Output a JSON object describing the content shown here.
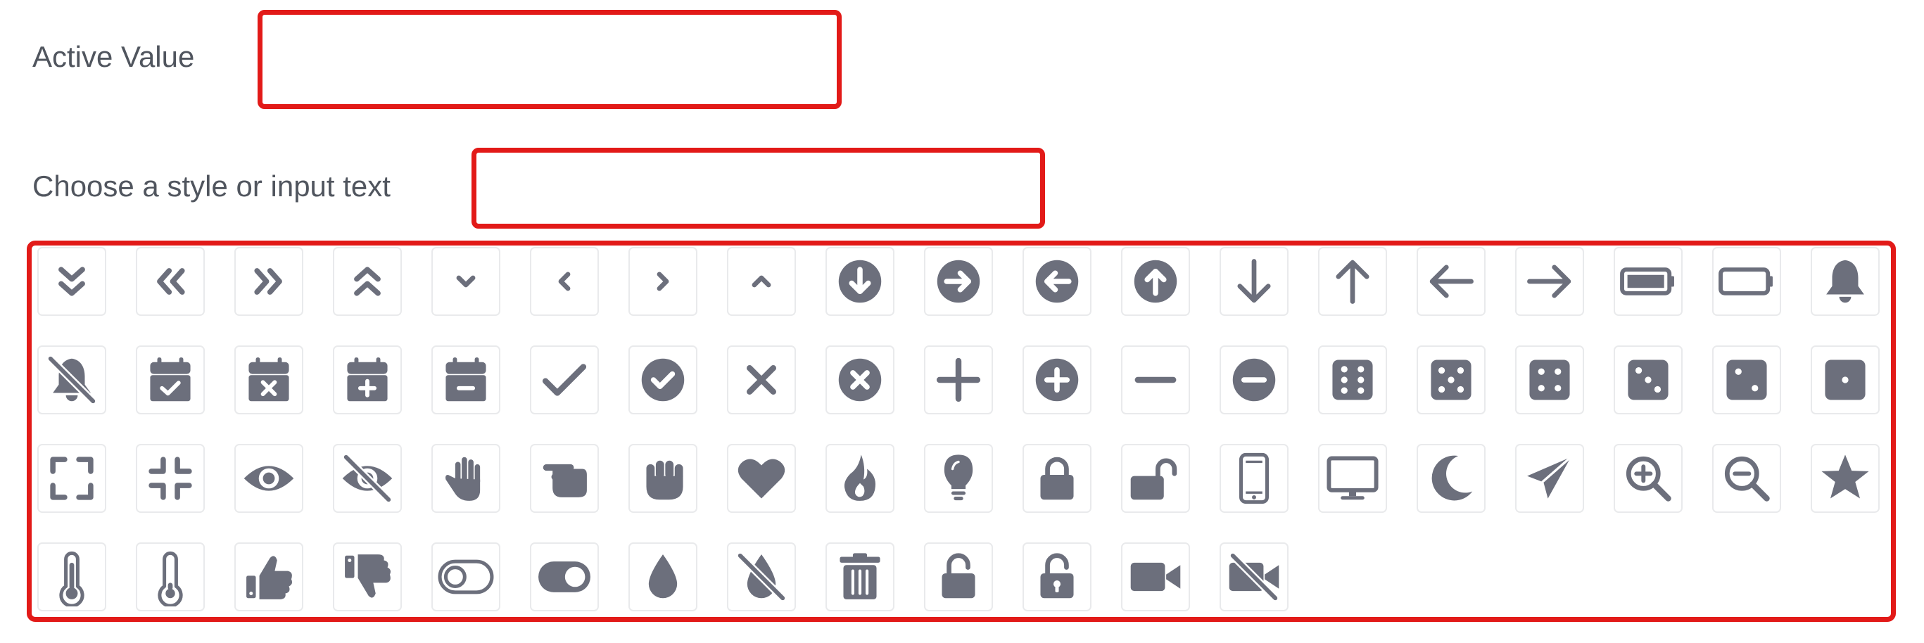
{
  "form": {
    "active_value_label": "Active Value",
    "active_value": "",
    "style_label": "Choose a style or input text",
    "style_value": ""
  },
  "theme": {
    "icon_color": "#6c6f7c",
    "border_color": "#e21a18",
    "tile_border": "#e9eaec"
  },
  "icon_palette": [
    "chevron-double-down",
    "chevron-double-left",
    "chevron-double-right",
    "chevron-double-up",
    "chevron-down",
    "chevron-left",
    "chevron-right",
    "chevron-up",
    "circle-arrow-down",
    "circle-arrow-right",
    "circle-arrow-left",
    "circle-arrow-up",
    "arrow-down",
    "arrow-up",
    "arrow-left",
    "arrow-right",
    "battery-full",
    "battery-empty",
    "bell",
    "bell-slash",
    "calendar-check",
    "calendar-xmark",
    "calendar-plus",
    "calendar-minus",
    "check",
    "circle-check",
    "xmark",
    "circle-xmark",
    "plus",
    "circle-plus",
    "minus",
    "circle-minus",
    "dice-six",
    "dice-five",
    "dice-four",
    "dice-three",
    "dice-two",
    "dice-one",
    "expand",
    "compress",
    "eye",
    "eye-slash",
    "hand",
    "hand-scissors",
    "hand-fist",
    "heart",
    "fire",
    "lightbulb",
    "lock",
    "lock-open",
    "mobile",
    "desktop",
    "moon",
    "paper-plane",
    "magnifying-glass-plus",
    "magnifying-glass-minus",
    "star",
    "thermometer-full",
    "thermometer-empty",
    "thumbs-up",
    "thumbs-down",
    "toggle-off",
    "toggle-on",
    "droplet",
    "droplet-slash",
    "trash",
    "unlock",
    "unlock-alt",
    "video",
    "video-slash"
  ]
}
